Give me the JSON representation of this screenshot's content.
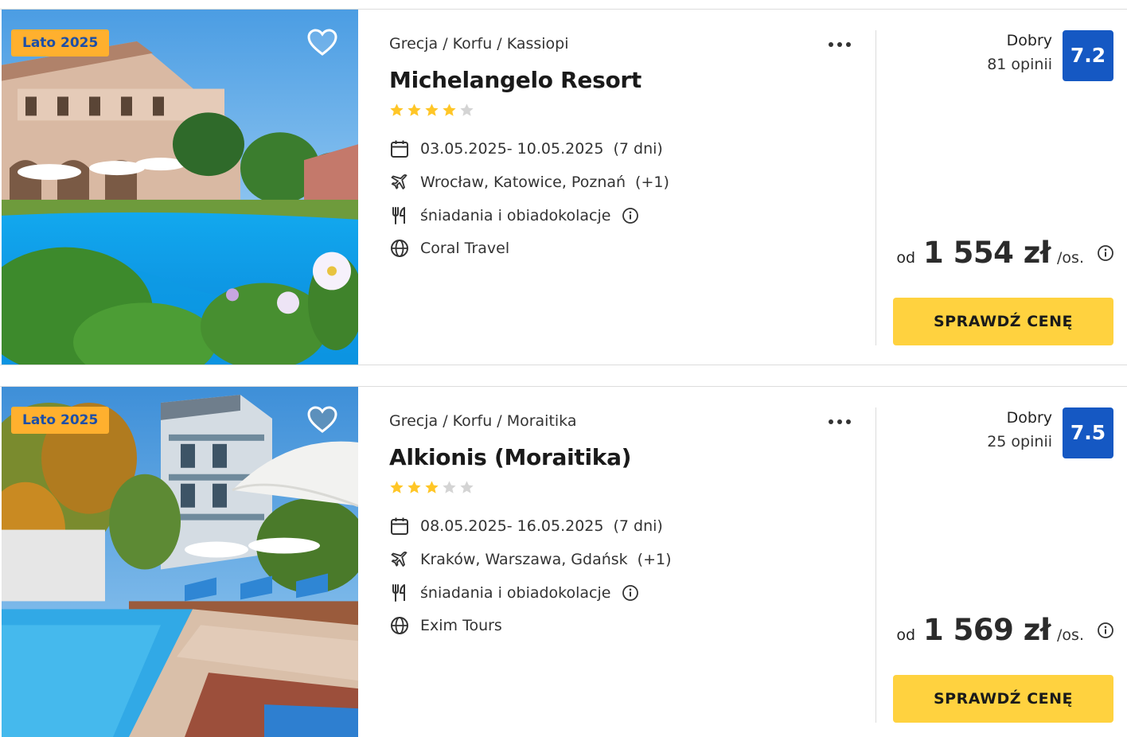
{
  "offers": [
    {
      "badge": "Lato 2025",
      "breadcrumb": [
        "Grecja",
        "Korfu",
        "Kassiopi"
      ],
      "breadcrumb_sep": "/",
      "name": "Michelangelo Resort",
      "stars": 4,
      "dates": "03.05.2025- 10.05.2025",
      "duration": "(7 dni)",
      "departure": "Wrocław, Katowice, Poznań",
      "departure_more": "(+1)",
      "board": "śniadania i obiadokolacje",
      "operator": "Coral Travel",
      "rating_label": "Dobry",
      "rating_count": "81 opinii",
      "rating_score": "7.2",
      "price_prefix": "od",
      "price": "1 554 zł",
      "price_unit": "/os.",
      "cta": "SPRAWDŹ CENĘ"
    },
    {
      "badge": "Lato 2025",
      "breadcrumb": [
        "Grecja",
        "Korfu",
        "Moraitika"
      ],
      "breadcrumb_sep": "/",
      "name": "Alkionis (Moraitika)",
      "stars": 3,
      "dates": "08.05.2025- 16.05.2025",
      "duration": "(7 dni)",
      "departure": "Kraków, Warszawa, Gdańsk",
      "departure_more": "(+1)",
      "board": "śniadania i obiadokolacje",
      "operator": "Exim Tours",
      "rating_label": "Dobry",
      "rating_count": "25 opinii",
      "rating_score": "7.5",
      "price_prefix": "od",
      "price": "1 569 zł",
      "price_unit": "/os.",
      "cta": "SPRAWDŹ CENĘ"
    }
  ],
  "colors": {
    "badge_bg": "#ffb02e",
    "badge_text": "#1d4fa7",
    "score_bg": "#1558c3",
    "cta_bg": "#ffd23f",
    "star_on": "#ffc627",
    "star_off": "#d4d4d4"
  },
  "icons": [
    "heart-icon",
    "more-dots-icon",
    "calendar-icon",
    "plane-icon",
    "cutlery-icon",
    "info-icon",
    "globe-icon",
    "star-icon"
  ]
}
